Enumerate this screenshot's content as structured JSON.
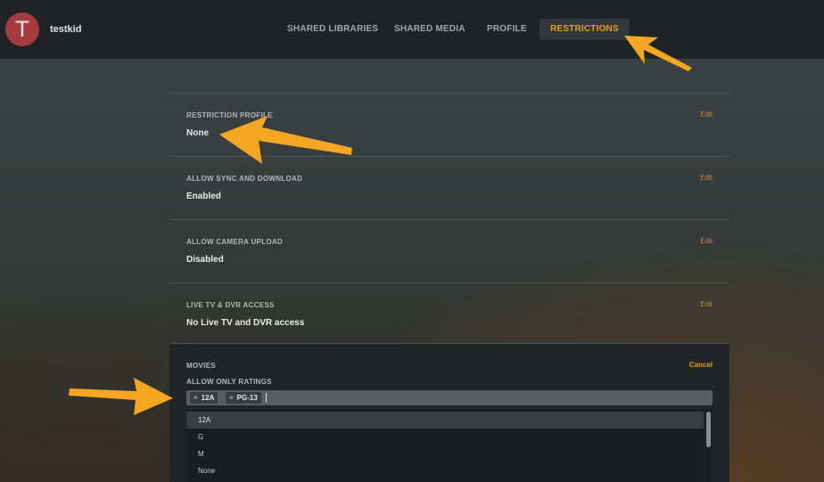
{
  "user": {
    "avatar_letter": "T",
    "name": "testkid"
  },
  "nav": {
    "tabs": [
      {
        "label": "SHARED LIBRARIES"
      },
      {
        "label": "SHARED MEDIA"
      },
      {
        "label": "PROFILE"
      },
      {
        "label": "RESTRICTIONS",
        "active": true
      }
    ]
  },
  "settings": [
    {
      "label": "RESTRICTION PROFILE",
      "value": "None",
      "action": "Edit"
    },
    {
      "label": "ALLOW SYNC AND DOWNLOAD",
      "value": "Enabled",
      "action": "Edit"
    },
    {
      "label": "ALLOW CAMERA UPLOAD",
      "value": "Disabled",
      "action": "Edit"
    },
    {
      "label": "LIVE TV & DVR ACCESS",
      "value": "No Live TV and DVR access",
      "action": "Edit"
    }
  ],
  "movies": {
    "label": "MOVIES",
    "sublabel": "ALLOW ONLY RATINGS",
    "action": "Cancel",
    "tags": [
      "12A",
      "PG-13"
    ],
    "tag_remove_glyph": "×",
    "options": [
      "12A",
      "G",
      "M",
      "None"
    ],
    "highlighted_option": "12A"
  },
  "colors": {
    "accent": "#e5a00d",
    "avatar": "#a53b3e",
    "arrow": "#f5a623"
  }
}
